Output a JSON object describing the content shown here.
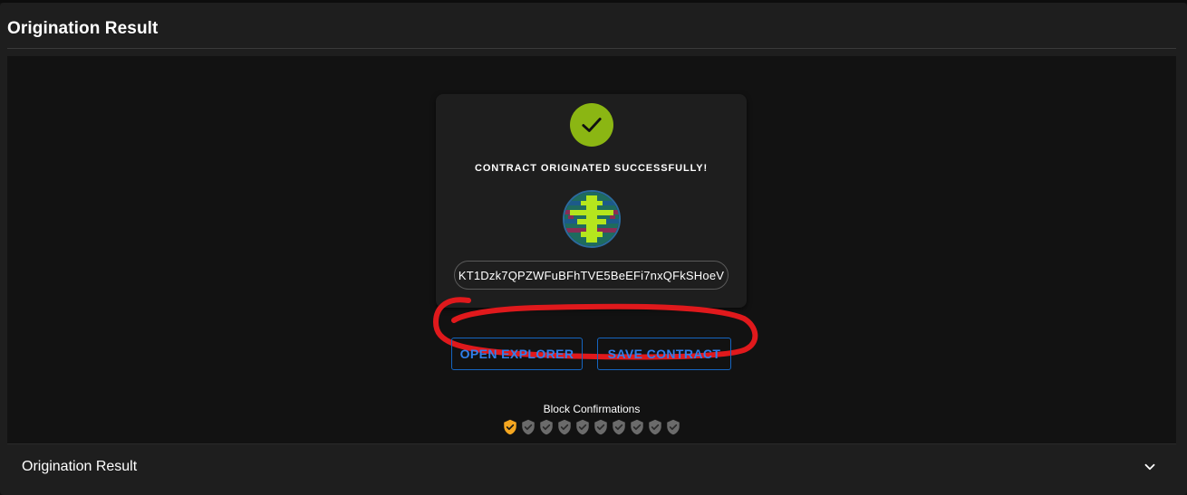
{
  "header": {
    "title": "Origination Result"
  },
  "card": {
    "success_icon": "check-icon",
    "success_color": "#8bb613",
    "success_message": "CONTRACT ORIGINATED SUCCESSFULLY!",
    "avatar_icon": "identicon",
    "contract_address": "KT1Dzk7QPZWFuBFhTVE5BeEFi7nxQFkSHoeV"
  },
  "actions": {
    "open_explorer_label": "OPEN EXPLORER",
    "save_contract_label": "SAVE CONTRACT",
    "accent_color": "#2f80ed"
  },
  "confirmations": {
    "label": "Block Confirmations",
    "confirmed": 1,
    "total": 10,
    "confirmed_color": "#f4a620",
    "pending_color": "#6b6b6b"
  },
  "accordion": {
    "title": "Origination Result",
    "icon": "chevron-down-icon",
    "expanded": false
  },
  "annotation": {
    "color": "#e0191c"
  }
}
